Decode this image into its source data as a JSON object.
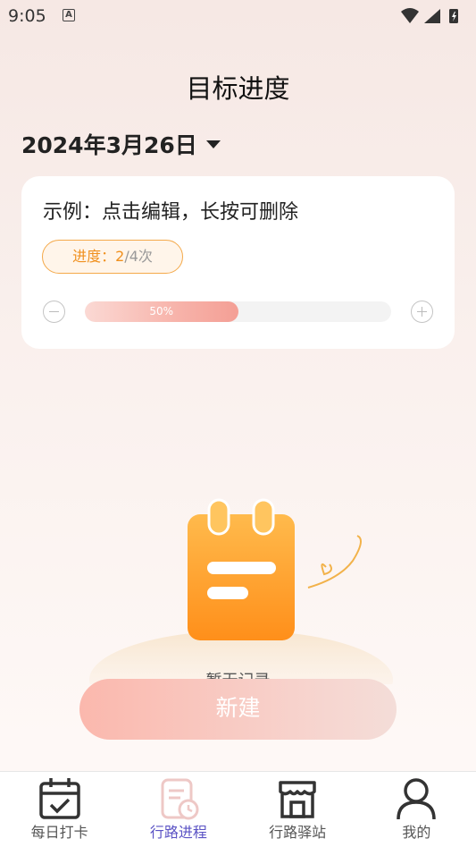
{
  "status_bar": {
    "time": "9:05",
    "notification_icon": "A"
  },
  "header": {
    "title": "目标进度"
  },
  "date_selector": {
    "label": "2024年3月26日"
  },
  "card": {
    "title": "示例：点击编辑，长按可删除",
    "badge_prefix": "进度：",
    "badge_done": "2",
    "badge_total": "/4次",
    "progress_percent_label": "50%",
    "progress_fraction": 0.5
  },
  "empty_state": {
    "text": "暂无记录"
  },
  "primary_button": {
    "label": "新建"
  },
  "colors": {
    "accent": "#5a52c4",
    "badge_orange": "#f0901e",
    "progress_pink": "#f49f95"
  },
  "tabs": [
    {
      "label": "每日打卡",
      "icon": "calendar-check-icon",
      "active": false
    },
    {
      "label": "行路进程",
      "icon": "document-clock-icon",
      "active": true
    },
    {
      "label": "行路驿站",
      "icon": "store-icon",
      "active": false
    },
    {
      "label": "我的",
      "icon": "user-icon",
      "active": false
    }
  ]
}
